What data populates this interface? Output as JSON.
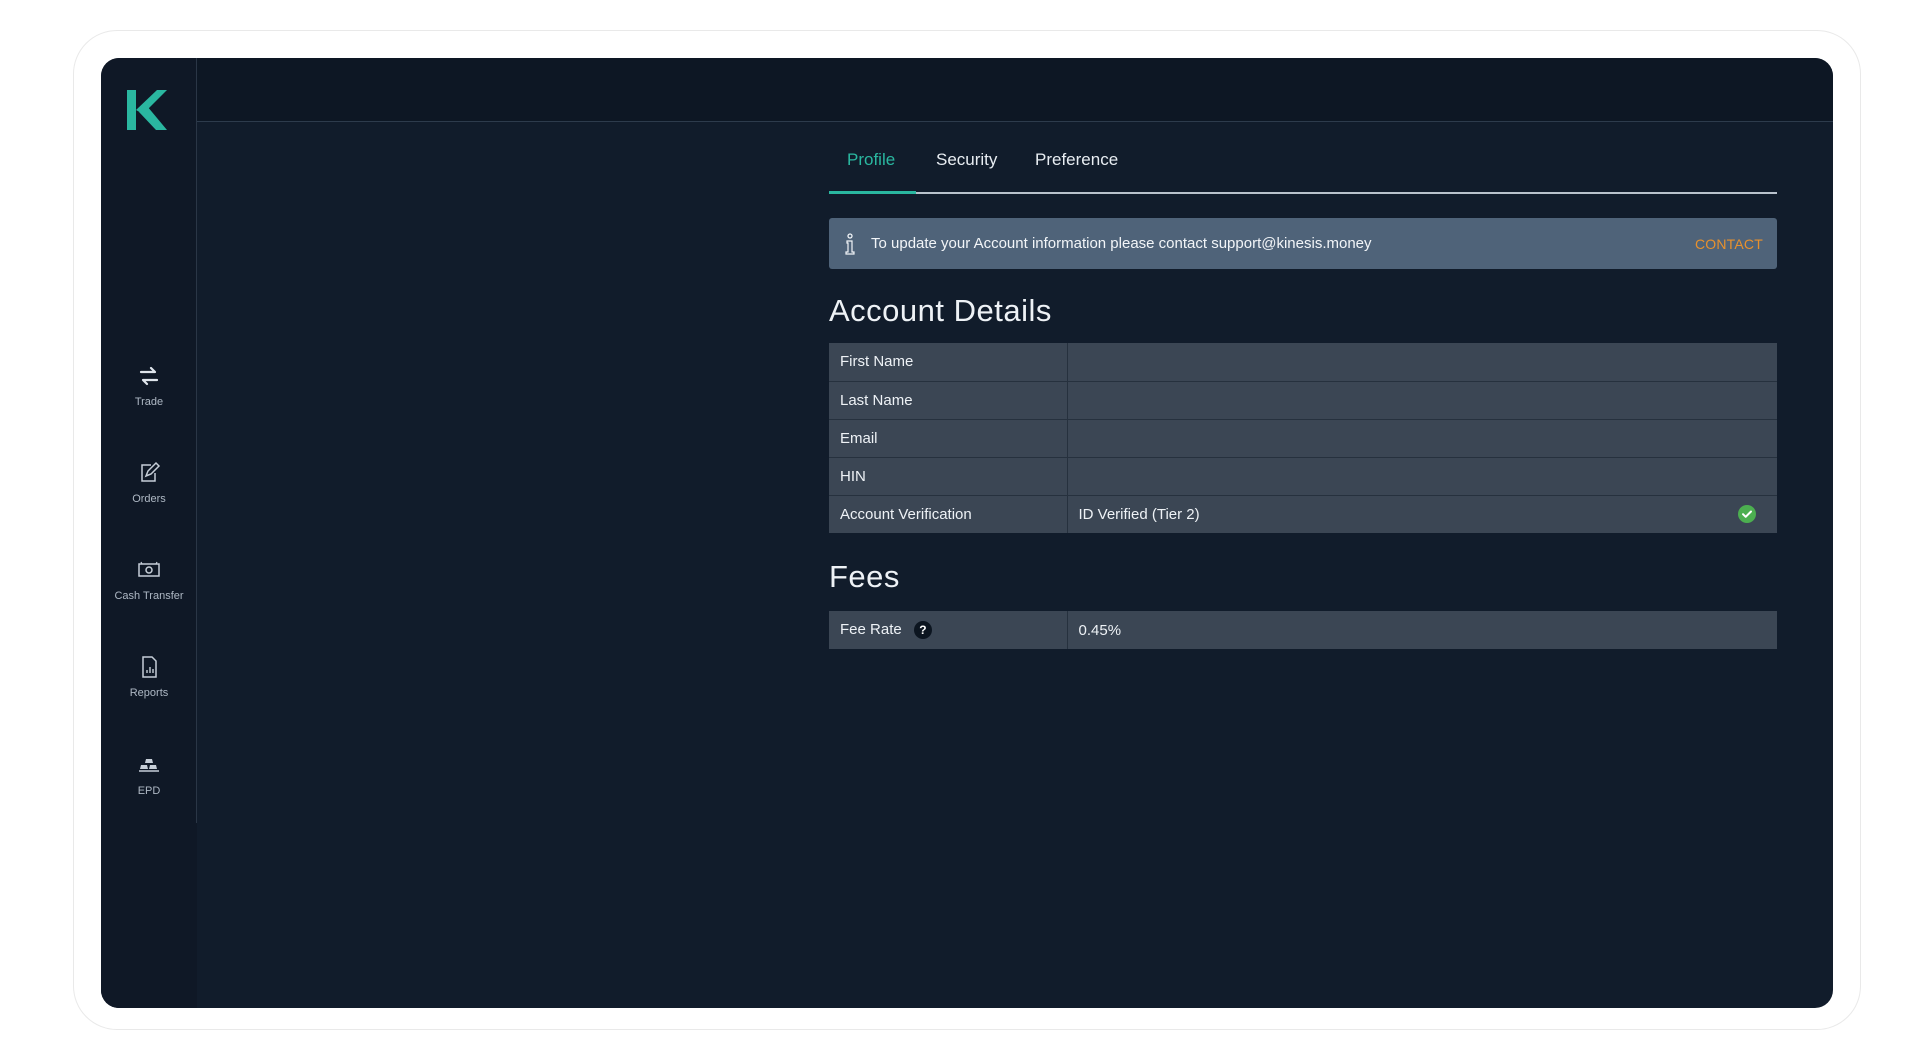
{
  "sidebar": {
    "logo_text": "K",
    "items": [
      {
        "label": "Trade",
        "icon": "arrows-swap-icon"
      },
      {
        "label": "Orders",
        "icon": "edit-document-icon"
      },
      {
        "label": "Cash Transfer",
        "icon": "cash-icon"
      },
      {
        "label": "Reports",
        "icon": "report-file-icon"
      },
      {
        "label": "EPD",
        "icon": "gold-bars-icon"
      }
    ]
  },
  "tabs": [
    {
      "label": "Profile",
      "active": true
    },
    {
      "label": "Security",
      "active": false
    },
    {
      "label": "Preference",
      "active": false
    }
  ],
  "alert": {
    "text": "To update your Account information please contact support@kinesis.money",
    "action": "CONTACT"
  },
  "account_details": {
    "title": "Account Details",
    "rows": [
      {
        "label": "First Name",
        "value": ""
      },
      {
        "label": "Last Name",
        "value": ""
      },
      {
        "label": "Email",
        "value": ""
      },
      {
        "label": "HIN",
        "value": ""
      },
      {
        "label": "Account Verification",
        "value": "ID Verified (Tier 2)"
      }
    ]
  },
  "fees": {
    "title": "Fees",
    "rows": [
      {
        "label": "Fee Rate",
        "value": "0.45%"
      }
    ],
    "help_glyph": "?"
  },
  "colors": {
    "accent": "#2ab7a0",
    "contact": "#e8912d",
    "verified": "#4caf50"
  }
}
